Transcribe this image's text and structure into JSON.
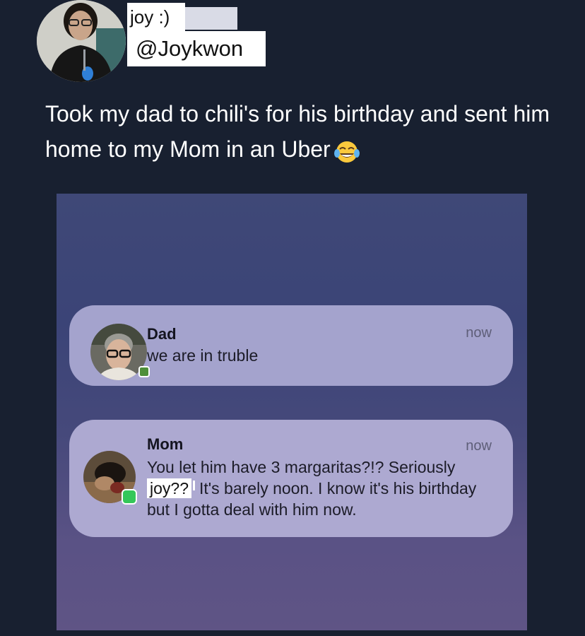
{
  "tweet": {
    "display_name": "joy :)",
    "handle": "@Joykwon",
    "text": "Took my dad to chili's for his birthday and sent him home to my Mom in an Uber",
    "emoji": "face-with-tears-of-joy-icon"
  },
  "screenshot": {
    "notifications": [
      {
        "sender": "Dad",
        "time": "now",
        "body": "we are in truble"
      },
      {
        "sender": "Mom",
        "time": "now",
        "body_line1": "You let him have 3 margaritas?!? Seriously",
        "body_highlight": "joy??",
        "body_rest": "It's barely noon. I know it's his birthday but I gotta deal with him now."
      }
    ]
  },
  "colors": {
    "background": "#182030",
    "notification_bg": "#a4a3cd",
    "messages_badge": "#34c759"
  }
}
